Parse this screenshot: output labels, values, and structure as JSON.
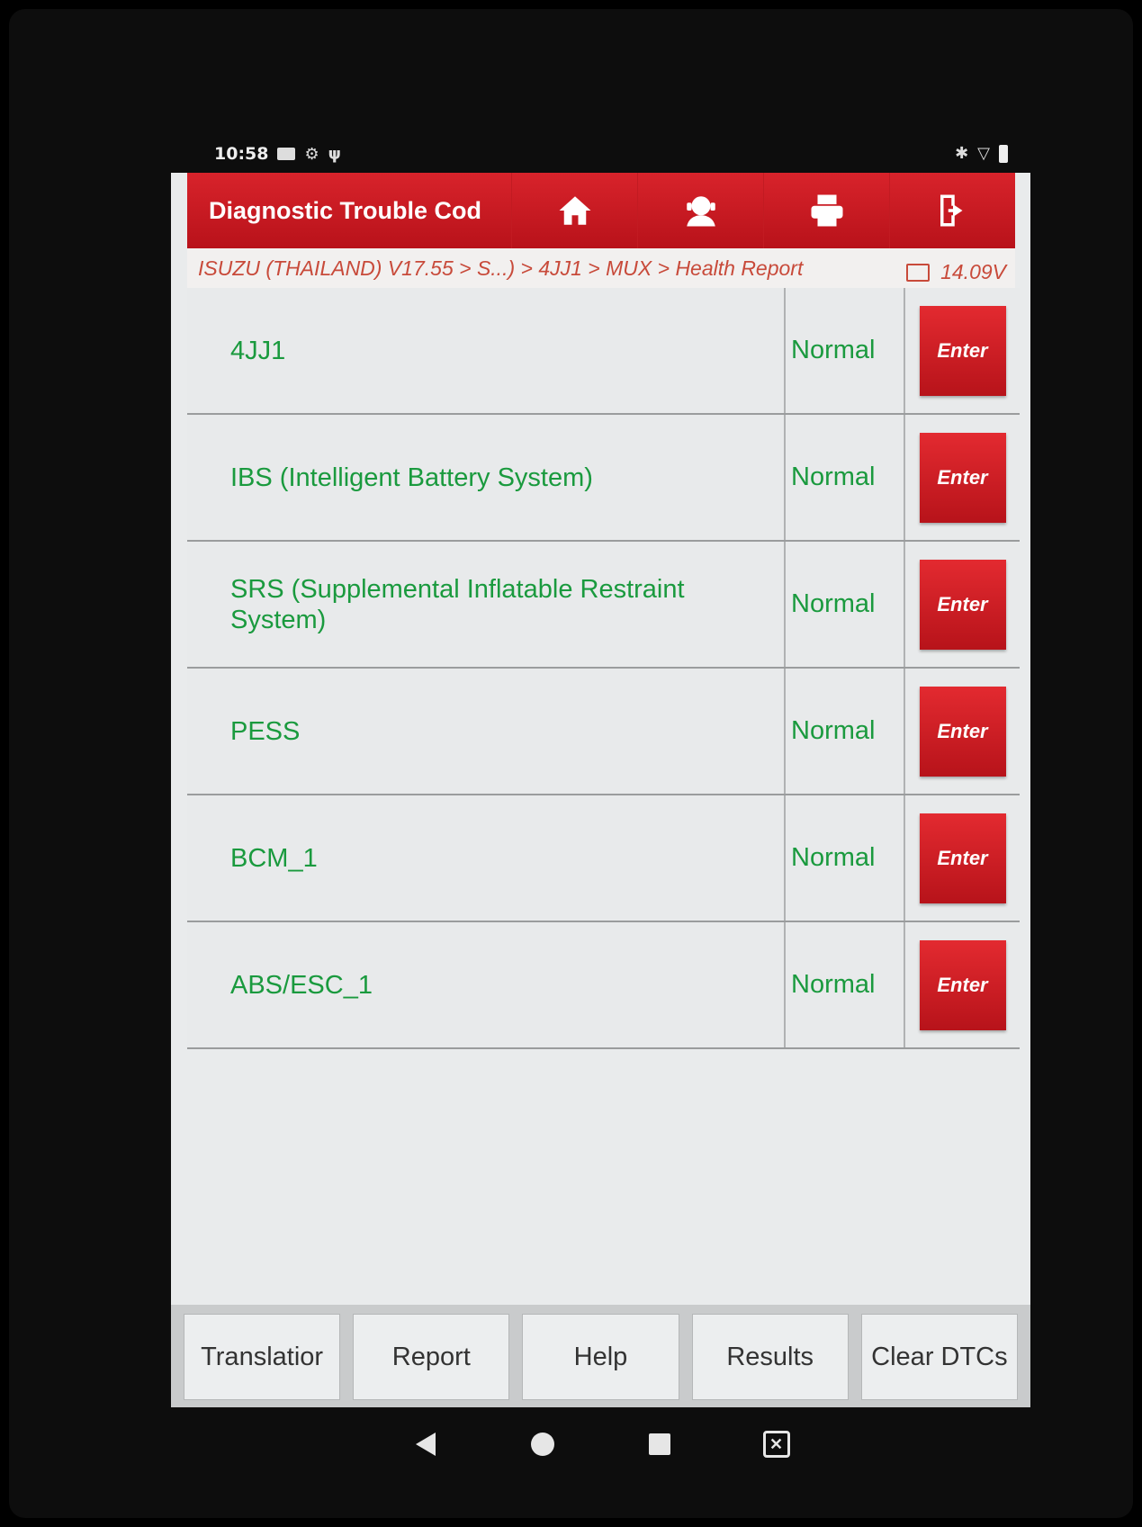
{
  "status_bar": {
    "time": "10:58"
  },
  "header": {
    "title": "Diagnostic Trouble Cod",
    "buttons": [
      "home-icon",
      "support-icon",
      "printer-icon",
      "exit-icon"
    ]
  },
  "breadcrumb": {
    "path": "ISUZU (THAILAND) V17.55 > S...) > 4JJ1 > MUX > Health Report",
    "voltage": "14.09V"
  },
  "rows": [
    {
      "name": "4JJ1",
      "status": "Normal",
      "action": "Enter"
    },
    {
      "name": "IBS (Intelligent Battery System)",
      "status": "Normal",
      "action": "Enter"
    },
    {
      "name": "SRS (Supplemental Inflatable Restraint System)",
      "status": "Normal",
      "action": "Enter"
    },
    {
      "name": "PESS",
      "status": "Normal",
      "action": "Enter"
    },
    {
      "name": "BCM_1",
      "status": "Normal",
      "action": "Enter"
    },
    {
      "name": "ABS/ESC_1",
      "status": "Normal",
      "action": "Enter"
    }
  ],
  "toolbar": {
    "translation": "Translatior",
    "report": "Report",
    "help": "Help",
    "results": "Results",
    "clear_dtcs": "Clear DTCs"
  },
  "colors": {
    "header_red": "#d8232b",
    "status_green": "#1a9a3e",
    "crumb_text": "#c84a3a"
  }
}
